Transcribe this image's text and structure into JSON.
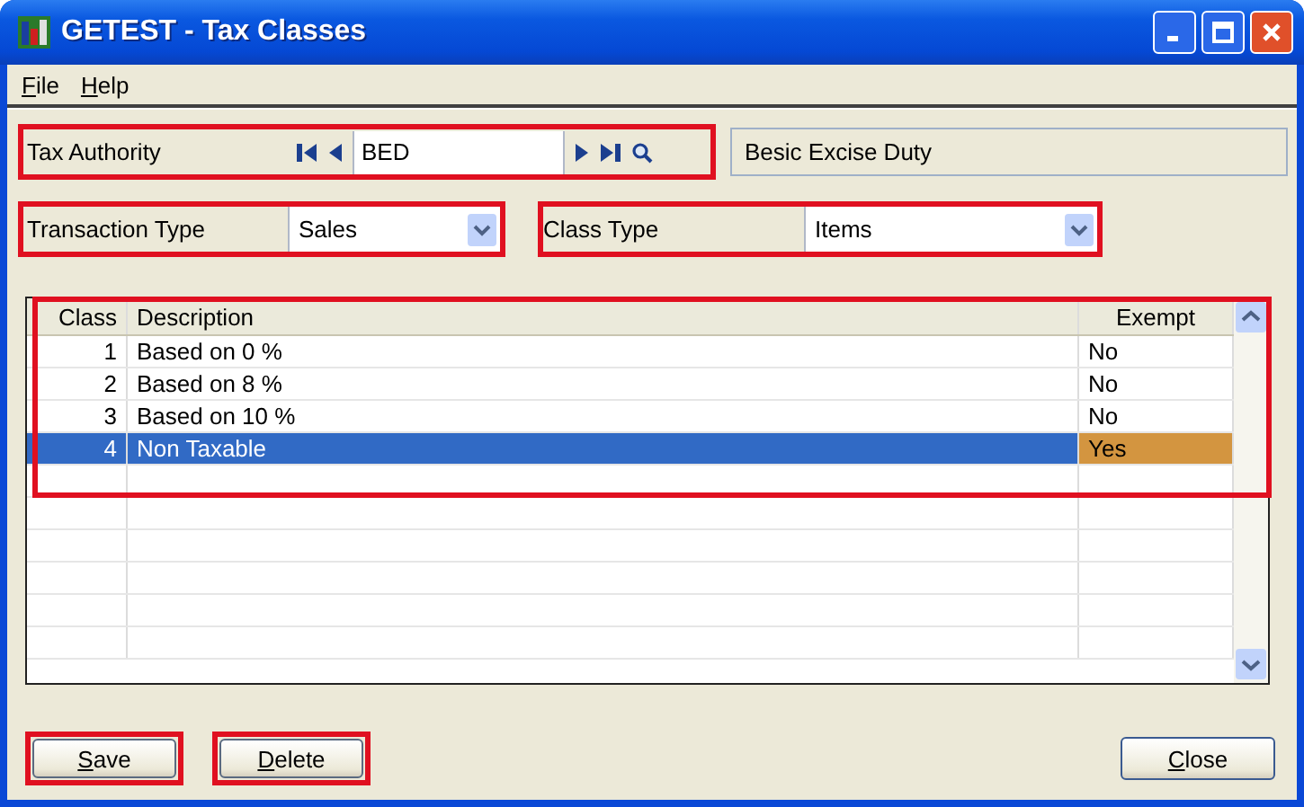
{
  "window": {
    "title": "GETEST - Tax Classes"
  },
  "menu": [
    {
      "label": "File"
    },
    {
      "label": "Help"
    }
  ],
  "tax_authority": {
    "label": "Tax Authority",
    "value": "BED",
    "description": "Besic Excise Duty"
  },
  "transaction_type": {
    "label": "Transaction Type",
    "value": "Sales"
  },
  "class_type": {
    "label": "Class Type",
    "value": "Items"
  },
  "table": {
    "columns": [
      "Class",
      "Description",
      "Exempt"
    ],
    "rows": [
      {
        "cells": [
          "1",
          "Based on 0 %",
          "No"
        ],
        "selected": false
      },
      {
        "cells": [
          "2",
          "Based on 8 %",
          "No"
        ],
        "selected": false
      },
      {
        "cells": [
          "3",
          "Based on 10 %",
          "No"
        ],
        "selected": false
      },
      {
        "cells": [
          "4",
          "Non Taxable",
          "Yes"
        ],
        "selected": true
      }
    ]
  },
  "buttons": [
    {
      "label": "Save",
      "highlighted": true
    },
    {
      "label": "Delete",
      "highlighted": true
    }
  ],
  "close_button": {
    "label": "Close"
  }
}
